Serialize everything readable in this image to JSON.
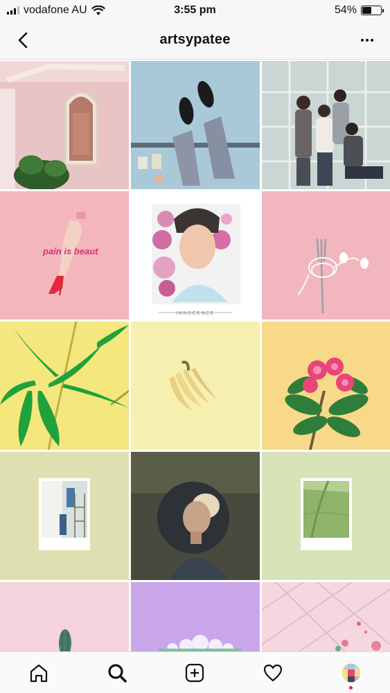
{
  "status_bar": {
    "carrier": "vodafone AU",
    "time": "3:55 pm",
    "battery": "54%",
    "battery_level": 0.54,
    "wifi_icon": "wifi-icon",
    "signal_icon": "signal-icon"
  },
  "header": {
    "title": "artsypatee",
    "back_icon": "chevron-left-icon",
    "more_icon": "more-dots-icon"
  },
  "grid": {
    "posts": [
      {
        "description": "pink building with arched window"
      },
      {
        "description": "sneakers on blue ground"
      },
      {
        "description": "group of four friends"
      },
      {
        "description": "mannequin leg on pink",
        "overlay_text": "pain is beaut"
      },
      {
        "description": "illustrated portrait with flowers",
        "overlay_text": "INNOCENCE"
      },
      {
        "description": "earphones on fork"
      },
      {
        "description": "bamboo leaves on yellow"
      },
      {
        "description": "bananas on yellow"
      },
      {
        "description": "pink flower on yellow"
      },
      {
        "description": "polaroid with painters"
      },
      {
        "description": "portrait in circle"
      },
      {
        "description": "polaroid with green field"
      },
      {
        "description": "cactus on pink"
      },
      {
        "description": "flowers on purple"
      },
      {
        "description": "pink tiles"
      }
    ]
  },
  "bottom_nav": {
    "items": [
      {
        "name": "home",
        "icon": "home-icon"
      },
      {
        "name": "search",
        "icon": "search-icon"
      },
      {
        "name": "new-post",
        "icon": "plus-square-icon"
      },
      {
        "name": "activity",
        "icon": "heart-icon"
      },
      {
        "name": "profile",
        "icon": "profile-avatar"
      }
    ]
  },
  "colors": {
    "accent": "#e0245e",
    "bar_background": "#f7f7f7",
    "separator": "#dcdcdc"
  }
}
